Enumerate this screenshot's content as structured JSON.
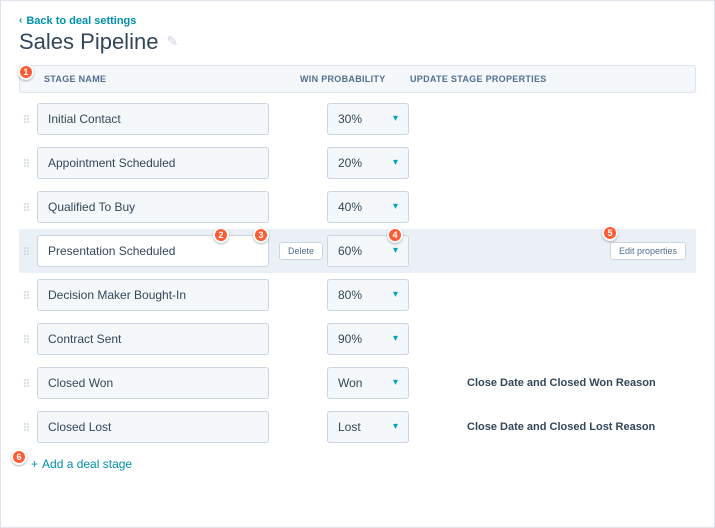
{
  "back_link": "Back to deal settings",
  "title": "Sales Pipeline",
  "columns": {
    "name": "STAGE NAME",
    "prob": "WIN PROBABILITY",
    "update": "UPDATE STAGE PROPERTIES"
  },
  "stages": [
    {
      "name": "Initial Contact",
      "prob": "30%",
      "update": ""
    },
    {
      "name": "Appointment Scheduled",
      "prob": "20%",
      "update": ""
    },
    {
      "name": "Qualified To Buy",
      "prob": "40%",
      "update": ""
    },
    {
      "name": "Presentation Scheduled",
      "prob": "60%",
      "update": "",
      "editing": true,
      "delete_label": "Delete",
      "edit_props_label": "Edit properties"
    },
    {
      "name": "Decision Maker Bought-In",
      "prob": "80%",
      "update": ""
    },
    {
      "name": "Contract Sent",
      "prob": "90%",
      "update": ""
    },
    {
      "name": "Closed Won",
      "prob": "Won",
      "update": "Close Date and Closed Won Reason"
    },
    {
      "name": "Closed Lost",
      "prob": "Lost",
      "update": "Close Date and Closed Lost Reason"
    }
  ],
  "add_stage": "Add a deal stage",
  "callouts": [
    "1",
    "2",
    "3",
    "4",
    "5",
    "6"
  ]
}
